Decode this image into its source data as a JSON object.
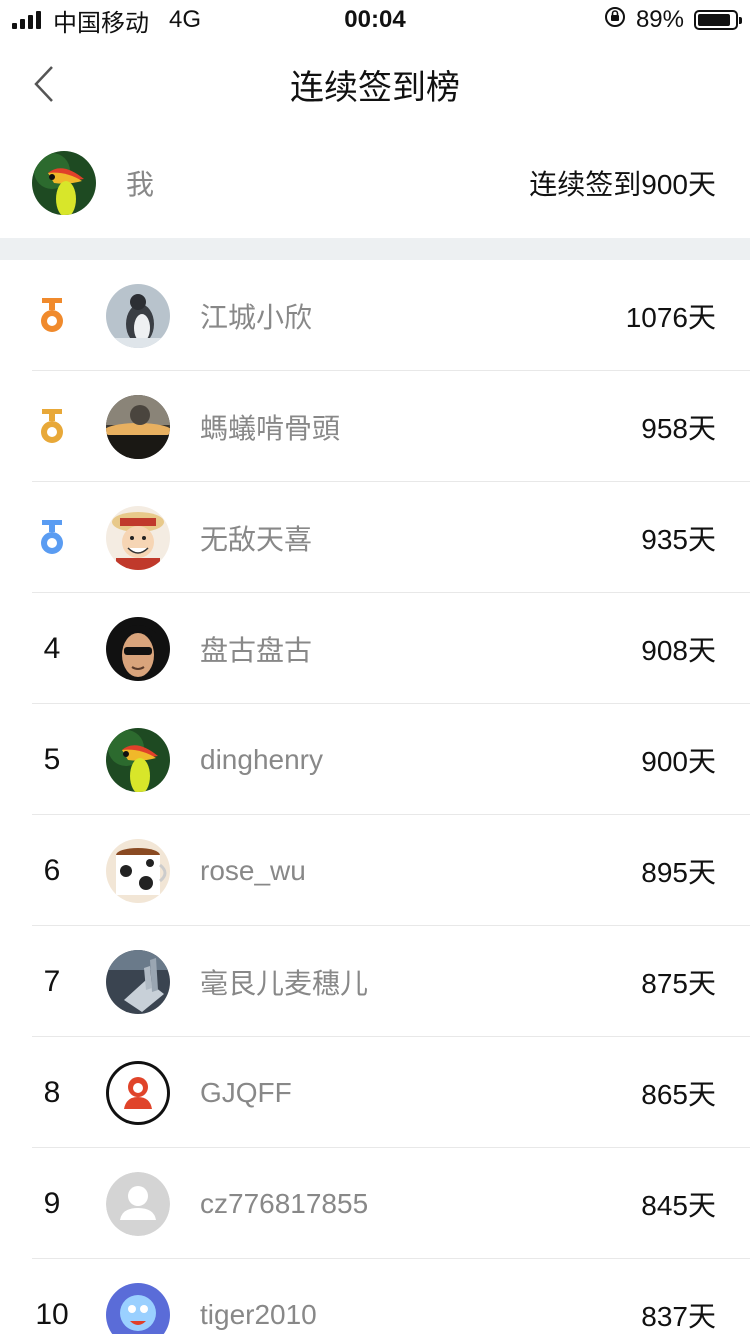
{
  "status_bar": {
    "carrier": "中国移动",
    "network": "4G",
    "time": "00:04",
    "battery": "89%",
    "battery_level": 0.89
  },
  "nav": {
    "title": "连续签到榜",
    "back_icon": "chevron-left-icon"
  },
  "me": {
    "name": "我",
    "days": "连续签到900天",
    "avatar": "toucan-avatar"
  },
  "colors": {
    "gold_medal": "#f08a2c",
    "silver_medal": "#e8a838",
    "bronze_medal": "#5a9cf2",
    "separator": "#edf0f2"
  },
  "rows": [
    {
      "rank": "",
      "medal": "gold-medal-icon",
      "name": "江城小欣",
      "days": "1076天",
      "avatar": "penguin-avatar"
    },
    {
      "rank": "",
      "medal": "silver-medal-icon",
      "name": "螞蟻啃骨頭",
      "days": "958天",
      "avatar": "sunset-avatar"
    },
    {
      "rank": "",
      "medal": "bronze-medal-icon",
      "name": "无敌天喜",
      "days": "935天",
      "avatar": "anime-avatar"
    },
    {
      "rank": "4",
      "medal": "",
      "name": "盘古盘古",
      "days": "908天",
      "avatar": "sunglasses-avatar"
    },
    {
      "rank": "5",
      "medal": "",
      "name": "dinghenry",
      "days": "900天",
      "avatar": "toucan-avatar"
    },
    {
      "rank": "6",
      "medal": "",
      "name": "rose_wu",
      "days": "895天",
      "avatar": "cup-avatar"
    },
    {
      "rank": "7",
      "medal": "",
      "name": "毫艮儿麦穗儿",
      "days": "875天",
      "avatar": "crystal-avatar"
    },
    {
      "rank": "8",
      "medal": "",
      "name": "GJQFF",
      "days": "865天",
      "avatar": "person-red-avatar"
    },
    {
      "rank": "9",
      "medal": "",
      "name": "cz776817855",
      "days": "845天",
      "avatar": "default-user-avatar"
    },
    {
      "rank": "10",
      "medal": "",
      "name": "tiger2010",
      "days": "837天",
      "avatar": "cartoon-avatar"
    }
  ]
}
